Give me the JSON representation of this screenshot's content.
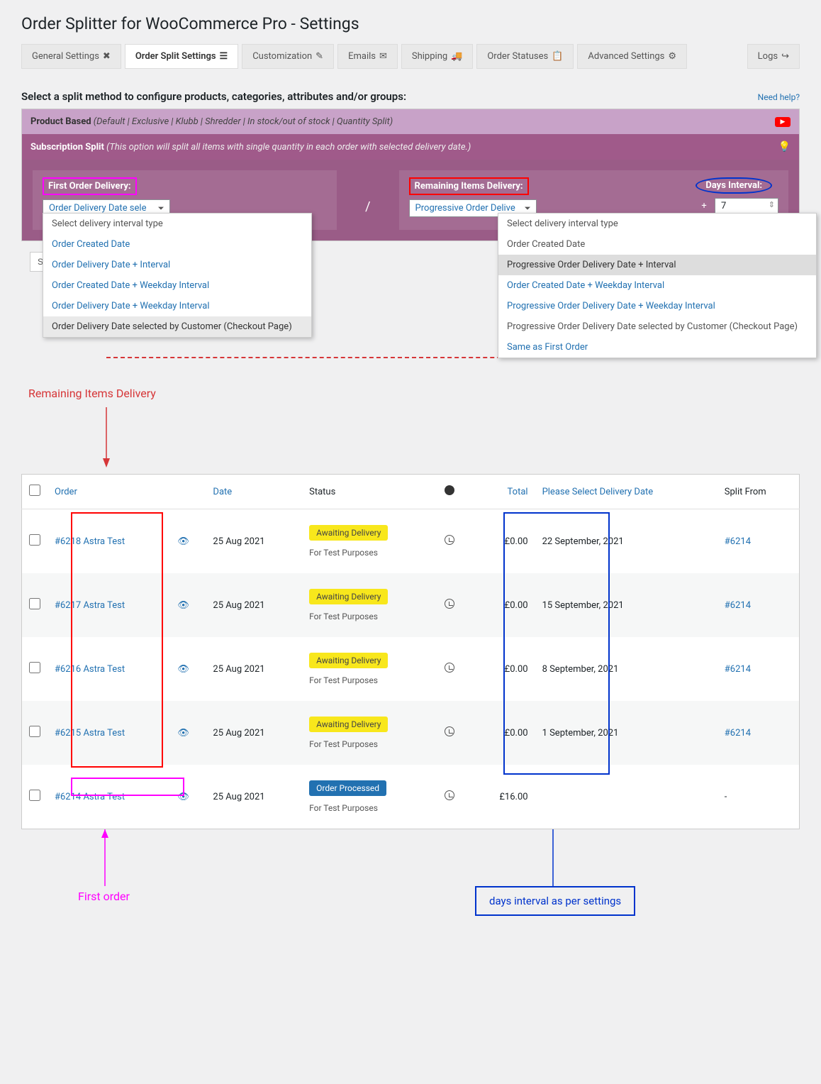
{
  "page_title": "Order Splitter for WooCommerce Pro - Settings",
  "tabs": [
    {
      "label": "General Settings",
      "icon": "tools"
    },
    {
      "label": "Order Split Settings",
      "icon": "sliders",
      "active": true
    },
    {
      "label": "Customization",
      "icon": "edit"
    },
    {
      "label": "Emails",
      "icon": "envelope"
    },
    {
      "label": "Shipping",
      "icon": "truck"
    },
    {
      "label": "Order Statuses",
      "icon": "clipboard"
    },
    {
      "label": "Advanced Settings",
      "icon": "cogs"
    },
    {
      "label": "Logs",
      "icon": "login"
    }
  ],
  "section_heading": "Select a split method to configure products, categories, attributes and/or groups:",
  "help_link": "Need help?",
  "product_based": {
    "label": "Product Based",
    "desc": "(Default | Exclusive | Klubb | Shredder | In stock/out of stock | Quantity Split)"
  },
  "subscription_split": {
    "label": "Subscription Split",
    "desc": "(This option will split all items with single quantity in each order with selected delivery date.)"
  },
  "first_order": {
    "label": "First Order Delivery:",
    "selected": "Order Delivery Date sele",
    "options": [
      {
        "text": "Select delivery interval type",
        "muted": true
      },
      {
        "text": "Order Created Date"
      },
      {
        "text": "Order Delivery Date + Interval"
      },
      {
        "text": "Order Created Date + Weekday Interval"
      },
      {
        "text": "Order Delivery Date + Weekday Interval"
      },
      {
        "text": "Order Delivery Date selected by Customer (Checkout Page)",
        "selected": true
      }
    ]
  },
  "remaining": {
    "label": "Remaining Items Delivery:",
    "selected": "Progressive Order Delive",
    "days_label": "Days Interval:",
    "days_value": "7",
    "options": [
      {
        "text": "Select delivery interval type",
        "muted": true
      },
      {
        "text": "Order Created Date",
        "muted": true
      },
      {
        "text": "Progressive Order Delivery Date + Interval",
        "selected": true
      },
      {
        "text": "Order Created Date + Weekday Interval"
      },
      {
        "text": "Progressive Order Delivery Date + Weekday Interval"
      },
      {
        "text": "Progressive Order Delivery Date selected by Customer (Checkout Page)",
        "muted": true
      },
      {
        "text": "Same as First Order"
      }
    ]
  },
  "save_label": "Sa",
  "annotation_remaining": "Remaining Items Delivery",
  "annotation_first": "First order",
  "annotation_days": "days interval as per settings",
  "table": {
    "headers": {
      "order": "Order",
      "date": "Date",
      "status": "Status",
      "total": "Total",
      "delivery": "Please Select Delivery Date",
      "split_from": "Split From"
    },
    "rows": [
      {
        "order": "#6218 Astra Test",
        "date": "25 Aug 2021",
        "status": "Awaiting Delivery",
        "note": "For Test Purposes",
        "total": "£0.00",
        "delivery": "22 September, 2021",
        "split": "#6214",
        "alt": false
      },
      {
        "order": "#6217 Astra Test",
        "date": "25 Aug 2021",
        "status": "Awaiting Delivery",
        "note": "For Test Purposes",
        "total": "£0.00",
        "delivery": "15 September, 2021",
        "split": "#6214",
        "alt": true
      },
      {
        "order": "#6216 Astra Test",
        "date": "25 Aug 2021",
        "status": "Awaiting Delivery",
        "note": "For Test Purposes",
        "total": "£0.00",
        "delivery": "8 September, 2021",
        "split": "#6214",
        "alt": false
      },
      {
        "order": "#6215 Astra Test",
        "date": "25 Aug 2021",
        "status": "Awaiting Delivery",
        "note": "For Test Purposes",
        "total": "£0.00",
        "delivery": "1 September, 2021",
        "split": "#6214",
        "alt": true
      },
      {
        "order": "#6214 Astra Test",
        "date": "25 Aug 2021",
        "status": "Order Processed",
        "note": "For Test Purposes",
        "total": "£16.00",
        "delivery": "",
        "split": "-",
        "alt": false,
        "processed": true
      }
    ]
  }
}
